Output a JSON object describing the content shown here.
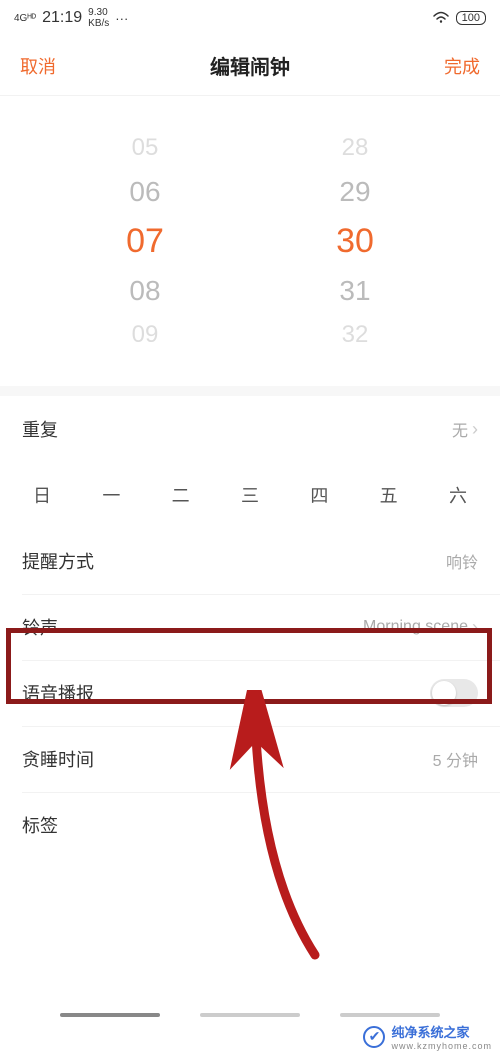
{
  "status_bar": {
    "network_badge": "4Gᴴᴰ",
    "time": "21:19",
    "speed_line1": "9.30",
    "speed_line2": "KB/s",
    "more": "···",
    "battery": "100"
  },
  "header": {
    "cancel": "取消",
    "title": "编辑闹钟",
    "done": "完成"
  },
  "picker": {
    "hours": [
      "05",
      "06",
      "07",
      "08",
      "09"
    ],
    "minutes": [
      "28",
      "29",
      "30",
      "31",
      "32"
    ],
    "selected_hour_index": 2,
    "selected_minute_index": 2
  },
  "rows": {
    "repeat": {
      "label": "重复",
      "value": "无"
    },
    "weekdays": [
      "日",
      "一",
      "二",
      "三",
      "四",
      "五",
      "六"
    ],
    "reminder": {
      "label": "提醒方式",
      "value": "响铃"
    },
    "ringtone": {
      "label": "铃声",
      "value": "Morning scene"
    },
    "voice": {
      "label": "语音播报"
    },
    "snooze": {
      "label": "贪睡时间",
      "value": "5 分钟"
    },
    "tag": {
      "label": "标签"
    }
  },
  "annotation": {
    "highlight_target": "ringtone-row",
    "arrow_color": "#b81c1c"
  },
  "watermark": {
    "brand": "纯净系统之家",
    "url": "www.kzmyhome.com"
  }
}
